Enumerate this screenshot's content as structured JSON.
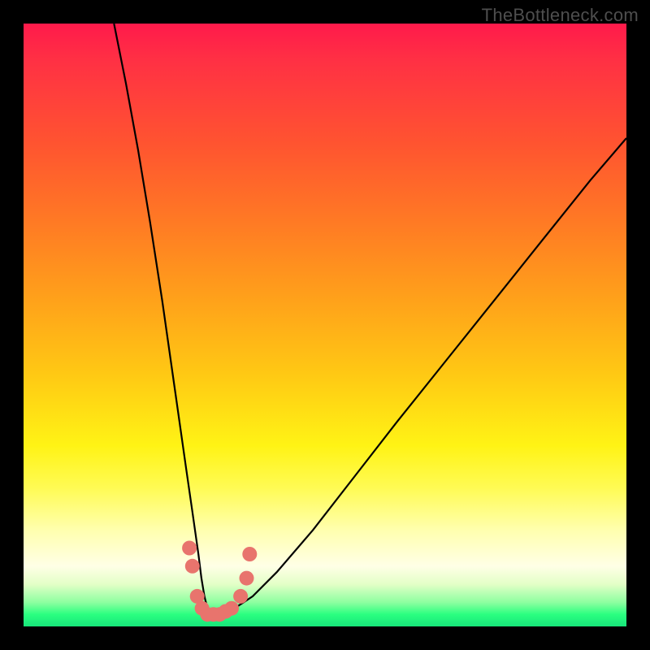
{
  "watermark": "TheBottleneck.com",
  "colors": {
    "black": "#000000",
    "curve": "#000000",
    "marker": "#e8746d",
    "top": "#ff1a4b",
    "mid": "#ffe015",
    "bottom": "#17e57a"
  },
  "chart_data": {
    "type": "line",
    "title": "",
    "xlabel": "",
    "ylabel": "",
    "xlim": [
      0,
      100
    ],
    "ylim": [
      0,
      100
    ],
    "note": "Axes unlabeled; values are relative positions in percent of plot area. Curve is a V-shaped bottleneck function; background gradient encodes red (high/bad) to green (low/good).",
    "series": [
      {
        "name": "bottleneck-curve",
        "x": [
          15,
          17,
          19,
          21,
          23,
          24,
          25,
          26,
          27,
          28,
          29,
          29.5,
          30,
          30.5,
          31,
          32,
          33,
          35,
          38,
          42,
          48,
          55,
          62,
          70,
          78,
          86,
          94,
          100
        ],
        "y": [
          100,
          90,
          79,
          67,
          54,
          47,
          40,
          33,
          26,
          19,
          12,
          8,
          5,
          3,
          2,
          2,
          2,
          3,
          5,
          9,
          16,
          25,
          34,
          44,
          54,
          64,
          74,
          81
        ]
      }
    ],
    "markers": {
      "name": "highlighted-points",
      "points": [
        {
          "x": 27.5,
          "y": 13
        },
        {
          "x": 28.0,
          "y": 10
        },
        {
          "x": 28.8,
          "y": 5
        },
        {
          "x": 29.6,
          "y": 3
        },
        {
          "x": 30.5,
          "y": 2
        },
        {
          "x": 31.5,
          "y": 2
        },
        {
          "x": 32.5,
          "y": 2
        },
        {
          "x": 33.5,
          "y": 2.5
        },
        {
          "x": 34.5,
          "y": 3
        },
        {
          "x": 36.0,
          "y": 5
        },
        {
          "x": 37.0,
          "y": 8
        },
        {
          "x": 37.5,
          "y": 12
        }
      ]
    }
  }
}
